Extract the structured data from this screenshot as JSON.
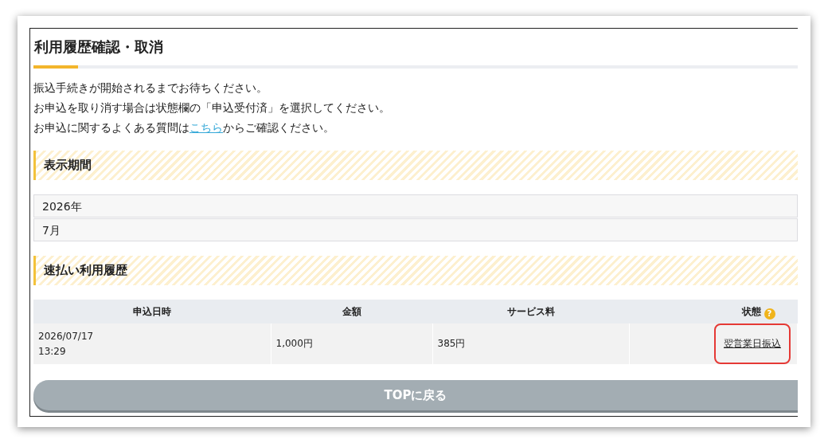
{
  "title": "利用履歴確認・取消",
  "notice": [
    "振込手続きが開始されるまでお待ちください。",
    "お申込を取り消す場合は状態欄の「申込受付済」を選択してください。"
  ],
  "faq": {
    "before": "お申込に関するよくある質問は",
    "link": "こちら",
    "after": "からご確認ください。"
  },
  "period": {
    "heading": "表示期間",
    "year": "2026年",
    "month": "7月"
  },
  "history": {
    "heading": "速払い利用履歴",
    "columns": [
      "申込日時",
      "金額",
      "サービス料",
      "状態"
    ],
    "help_icon": "?",
    "rows": [
      {
        "date": "2026/07/17",
        "time": "13:29",
        "amount": "1,000円",
        "fee": "385円",
        "status": "翌営業日振込",
        "highlighted": true
      }
    ]
  },
  "top_button": "TOPに戻る"
}
